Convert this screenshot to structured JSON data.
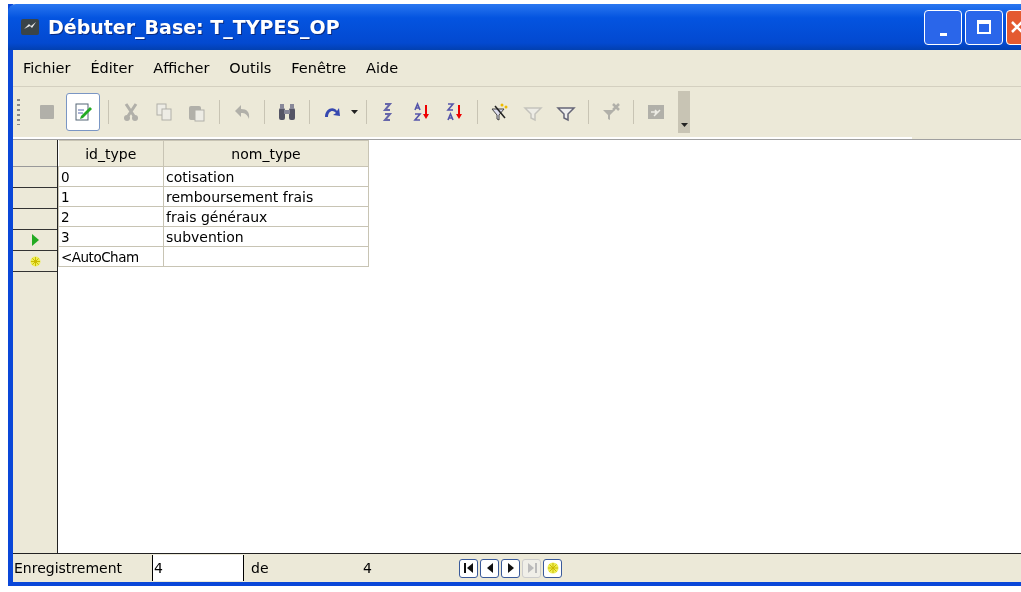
{
  "window": {
    "title": "Débuter_Base: T_TYPES_OP"
  },
  "menu": [
    {
      "label": "Fichier"
    },
    {
      "label": "Éditer"
    },
    {
      "label": "Afficher"
    },
    {
      "label": "Outils"
    },
    {
      "label": "Fenêtre"
    },
    {
      "label": "Aide"
    }
  ],
  "toolbar": [
    {
      "kind": "save",
      "disabled": true,
      "selected": false
    },
    {
      "kind": "edit",
      "disabled": false,
      "selected": true
    },
    {
      "kind": "sep"
    },
    {
      "kind": "cut",
      "disabled": true,
      "selected": false
    },
    {
      "kind": "copy",
      "disabled": true,
      "selected": false
    },
    {
      "kind": "paste",
      "disabled": true,
      "selected": false
    },
    {
      "kind": "sep"
    },
    {
      "kind": "undo",
      "disabled": true,
      "selected": false
    },
    {
      "kind": "sep"
    },
    {
      "kind": "find",
      "disabled": false,
      "selected": false
    },
    {
      "kind": "sep"
    },
    {
      "kind": "refresh",
      "disabled": false,
      "selected": false
    },
    {
      "kind": "dropdown"
    },
    {
      "kind": "sep"
    },
    {
      "kind": "sort",
      "disabled": false,
      "selected": false
    },
    {
      "kind": "sortasc",
      "disabled": false,
      "selected": false
    },
    {
      "kind": "sortdesc",
      "disabled": false,
      "selected": false
    },
    {
      "kind": "sep"
    },
    {
      "kind": "autofilter",
      "disabled": false,
      "selected": false
    },
    {
      "kind": "filter",
      "disabled": true,
      "selected": false
    },
    {
      "kind": "filter",
      "disabled": false,
      "selected": false
    },
    {
      "kind": "sep"
    },
    {
      "kind": "removefilter",
      "disabled": true,
      "selected": false
    },
    {
      "kind": "sep"
    },
    {
      "kind": "datasource",
      "disabled": true,
      "selected": false
    }
  ],
  "table": {
    "columns": [
      "id_type",
      "nom_type"
    ],
    "rows": [
      {
        "kind": "record",
        "selected": false,
        "cells": [
          "0",
          "cotisation"
        ]
      },
      {
        "kind": "record",
        "selected": false,
        "cells": [
          "1",
          "remboursement frais"
        ]
      },
      {
        "kind": "record",
        "selected": false,
        "cells": [
          "2",
          "frais généraux"
        ]
      },
      {
        "kind": "record",
        "selected": true,
        "cells": [
          "3",
          "subvention"
        ]
      },
      {
        "kind": "new",
        "selected": false,
        "cells": [
          "<AutoCham",
          ""
        ]
      }
    ]
  },
  "status_bar": {
    "label": "Enregistrement",
    "record": "4",
    "of_label": "de",
    "total": "4",
    "nav": [
      {
        "kind": "first",
        "disabled": false
      },
      {
        "kind": "prev",
        "disabled": false
      },
      {
        "kind": "next",
        "disabled": false
      },
      {
        "kind": "last",
        "disabled": true
      },
      {
        "kind": "new",
        "disabled": false
      }
    ]
  }
}
